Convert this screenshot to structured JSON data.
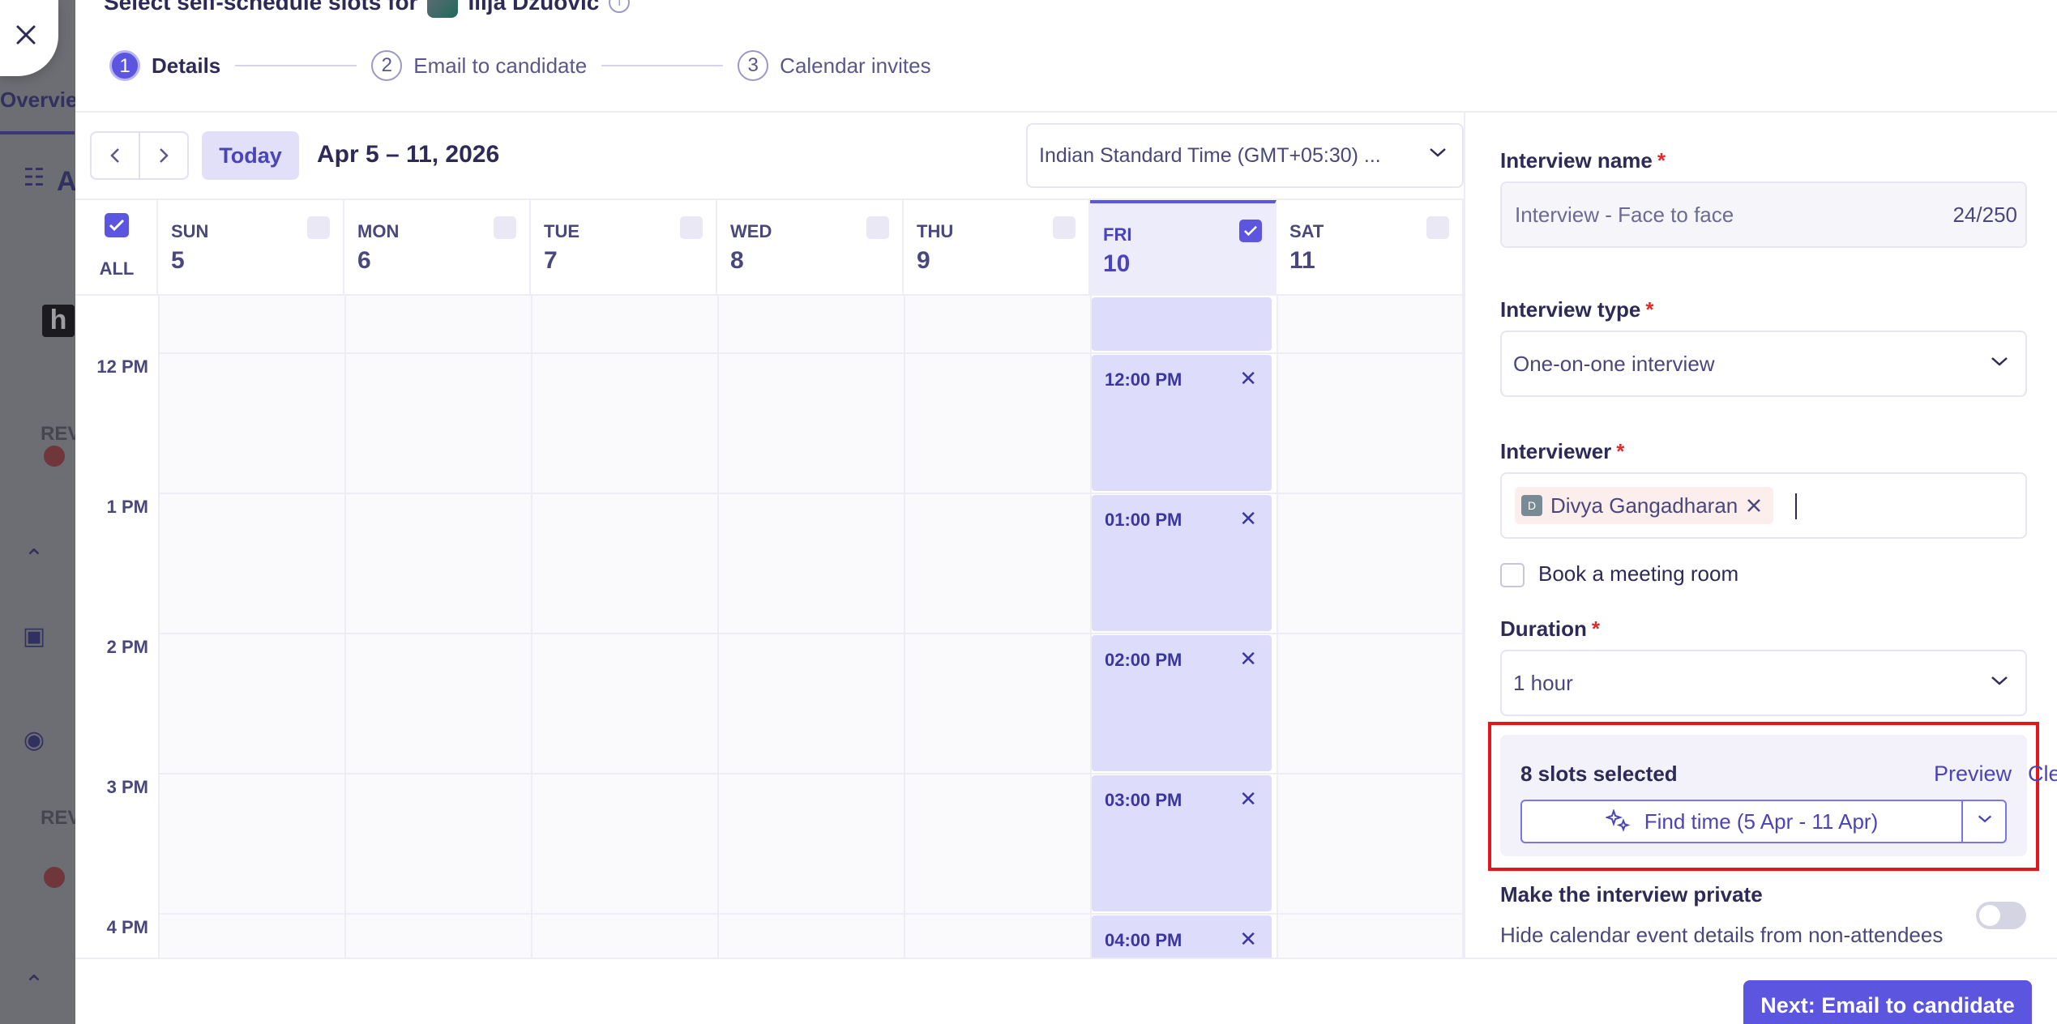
{
  "background": {
    "tab_label": "Overview",
    "section_label_1": "REV",
    "section_label_2": "REV",
    "letter_a": "A"
  },
  "modal": {
    "title_prefix": "Select self-schedule slots for",
    "candidate_name": "Ilija Dzuovic",
    "steps": [
      {
        "num": "1",
        "label": "Details"
      },
      {
        "num": "2",
        "label": "Email to candidate"
      },
      {
        "num": "3",
        "label": "Calendar invites"
      }
    ]
  },
  "calendar": {
    "today_label": "Today",
    "range_label": "Apr 5 – 11, 2026",
    "timezone": "Indian Standard Time (GMT+05:30) ...",
    "all_label": "ALL",
    "days": [
      {
        "name": "SUN",
        "num": "5",
        "checked": false
      },
      {
        "name": "MON",
        "num": "6",
        "checked": false
      },
      {
        "name": "TUE",
        "num": "7",
        "checked": false
      },
      {
        "name": "WED",
        "num": "8",
        "checked": false
      },
      {
        "name": "THU",
        "num": "9",
        "checked": false
      },
      {
        "name": "FRI",
        "num": "10",
        "checked": true
      },
      {
        "name": "SAT",
        "num": "11",
        "checked": false
      }
    ],
    "hours": [
      "12 PM",
      "1 PM",
      "2 PM",
      "3 PM",
      "4 PM"
    ],
    "slots": [
      "12:00 PM",
      "01:00 PM",
      "02:00 PM",
      "03:00 PM",
      "04:00 PM"
    ]
  },
  "form": {
    "interview_name_label": "Interview name",
    "interview_name_value": "Interview - Face to face",
    "interview_name_count": "24/250",
    "interview_type_label": "Interview type",
    "interview_type_value": "One-on-one interview",
    "interviewer_label": "Interviewer",
    "interviewer_initial": "D",
    "interviewer_name": "Divya Gangadharan",
    "meeting_room_label": "Book a meeting room",
    "duration_label": "Duration",
    "duration_value": "1 hour",
    "slots_selected": "8 slots selected",
    "preview_label": "Preview",
    "clear_label": "Clear",
    "find_time_label": "Find time (5 Apr - 11 Apr)",
    "private_title": "Make the interview private",
    "private_sub": "Hide calendar event details from non-attendees",
    "next_label": "Next: Email to candidate"
  },
  "colors": {
    "accent": "#5b55e0",
    "required": "#e02b2b",
    "highlight": "#e8141b"
  }
}
